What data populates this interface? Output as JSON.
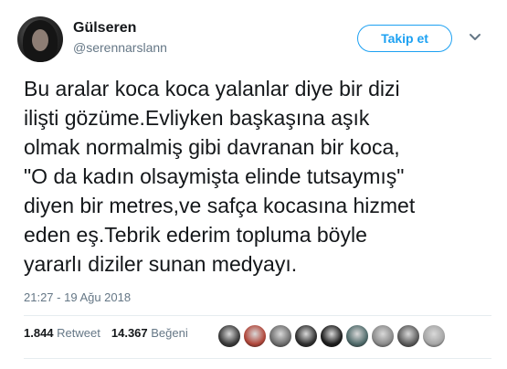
{
  "user": {
    "display_name": "Gülseren",
    "username": "@serennarslann"
  },
  "follow_button": {
    "label": "Takip et"
  },
  "tweet": {
    "lines": [
      "Bu aralar koca koca yalanlar diye bir dizi",
      "ilişti gözüme.Evliyken başkaşına aşık",
      "olmak normalmiş gibi davranan bir koca,",
      "\"O  da kadın olsaymişta elinde tutsaymış\"",
      "diyen bir metres,ve safça kocasına hizmet",
      "eden eş.Tebrik ederim topluma böyle",
      "yararlı diziler sunan medyayı."
    ],
    "timestamp": "21:27 - 19 Ağu 2018"
  },
  "stats": {
    "retweet_count": "1.844",
    "retweet_label": "Retweet",
    "like_count": "14.367",
    "like_label": "Beğeni"
  },
  "likers": [
    {
      "icon": "liker-avatar",
      "color": "#3a3a3a"
    },
    {
      "icon": "liker-avatar",
      "color": "#b0463a"
    },
    {
      "icon": "liker-avatar",
      "color": "#6d6d6d"
    },
    {
      "icon": "liker-avatar",
      "color": "#2f2f2f"
    },
    {
      "icon": "liker-avatar",
      "color": "#1c1c1c"
    },
    {
      "icon": "liker-avatar",
      "color": "#4f6a6a"
    },
    {
      "icon": "liker-avatar",
      "color": "#8a8a8a"
    },
    {
      "icon": "liker-avatar",
      "color": "#5a5a5a"
    },
    {
      "icon": "liker-avatar",
      "color": "#a5a5a5"
    }
  ],
  "colors": {
    "accent": "#1da1f2",
    "muted": "#657786",
    "text": "#14171a",
    "divider": "#e6ecf0"
  }
}
